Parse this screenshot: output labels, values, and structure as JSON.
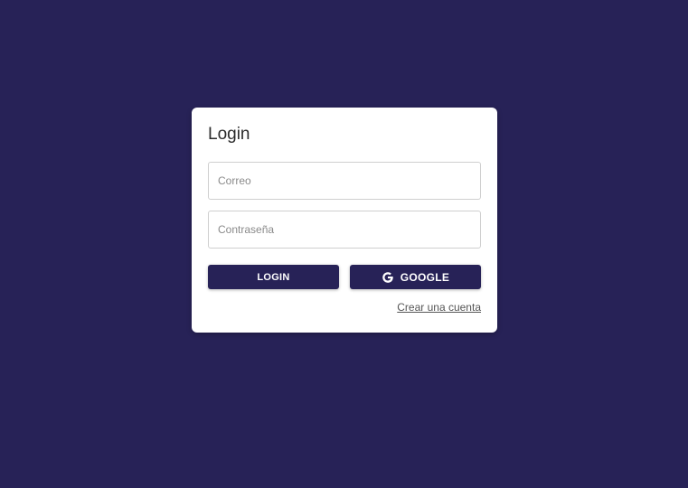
{
  "login_card": {
    "title": "Login",
    "email_placeholder": "Correo",
    "password_placeholder": "Contraseña",
    "login_button_label": "LOGIN",
    "google_button_label": "GOOGLE",
    "google_icon": "google-g-icon",
    "create_account_link": "Crear una cuenta"
  },
  "colors": {
    "background": "#272257",
    "card": "#ffffff",
    "button": "#272257",
    "button_text": "#ffffff"
  }
}
